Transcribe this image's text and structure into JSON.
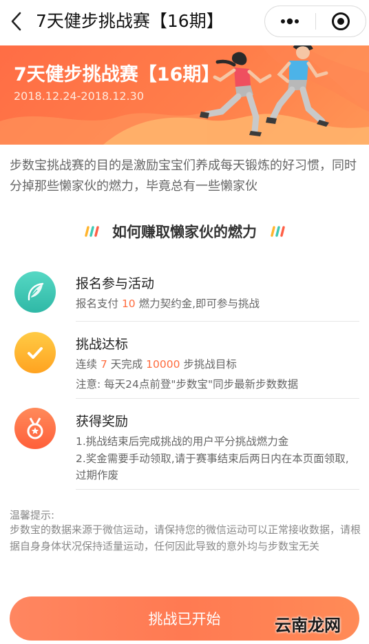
{
  "nav": {
    "title": "7天健步挑战赛【16期】",
    "back_icon": "chevron-left-icon",
    "more_icon": "more-dots-icon",
    "close_icon": "target-close-icon"
  },
  "banner": {
    "title": "7天健步挑战赛【16期】",
    "date_range": "2018.12.24-2018.12.30",
    "color": "#ff7a4a"
  },
  "intro": "步数宝挑战赛的目的是激励宝宝们养成每天锻炼的好习惯，同时分掉那些懒家伙的燃力，毕竟总有一些懒家伙",
  "section": {
    "title": "如何赚取懒家伙的燃力"
  },
  "steps": [
    {
      "icon": "feather-icon",
      "title": "报名参与活动",
      "line1_pre": "报名支付 ",
      "line1_hl": "10",
      "line1_post": " 燃力契约金,即可参与挑战"
    },
    {
      "icon": "checkmark-icon",
      "title": "挑战达标",
      "line1_pre": "连续 ",
      "line1_hl": "7",
      "line1_mid": " 天完成 ",
      "line1_hl2": "10000",
      "line1_post": " 步挑战目标",
      "line2": "注意: 每天24点前登\"步数宝\"同步最新步数数据"
    },
    {
      "icon": "medal-icon",
      "title": "获得奖励",
      "line1": "1.挑战结束后完成挑战的用户平分挑战燃力金",
      "line2": "2.奖金需要手动领取,请于赛事结束后两日内在本页面领取,过期作废"
    }
  ],
  "tips": {
    "label": "温馨提示:",
    "body": "步数宝的数据来源于微信运动，请保持您的微信运动可以正常接收数据，请根据自身身体状况保持适量运动，任何因此导致的意外均与步数宝无关"
  },
  "cta": {
    "label": "挑战已开始"
  },
  "watermark": "云南龙网",
  "colors": {
    "accent": "#ff6b3d",
    "icon_teal": "#3ec9b4",
    "icon_yellow": "#ffb52e",
    "icon_orange": "#ff6f45"
  }
}
